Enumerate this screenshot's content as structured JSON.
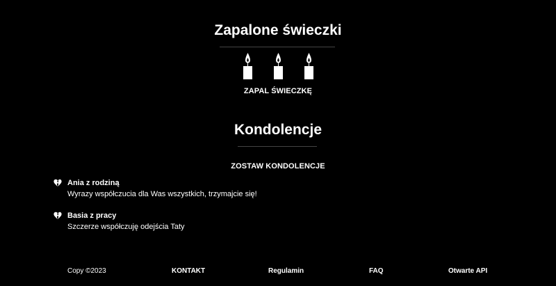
{
  "candles_section": {
    "title": "Zapalone świeczki",
    "candle_count": 3,
    "candle_icon": "candle-icon",
    "light_candle_label": "ZAPAL ŚWIECZKĘ"
  },
  "condolences_section": {
    "title": "Kondolencje",
    "leave_condolence_label": "ZOSTAW KONDOLENCJE",
    "entry_icon": "broken-heart-icon",
    "entries": [
      {
        "author": "Ania z rodziną",
        "message": "Wyrazy współczucia dla Was wszystkich, trzymajcie się!"
      },
      {
        "author": "Basia z pracy",
        "message": "Szczerze współczuję odejścia Taty"
      }
    ]
  },
  "footer": {
    "copyright": "Copy ©2023",
    "links": [
      "KONTAKT",
      "Regulamin",
      "FAQ",
      "Otwarte API"
    ]
  },
  "colors": {
    "background": "#000000",
    "text": "#ffffff",
    "divider": "#444444"
  }
}
